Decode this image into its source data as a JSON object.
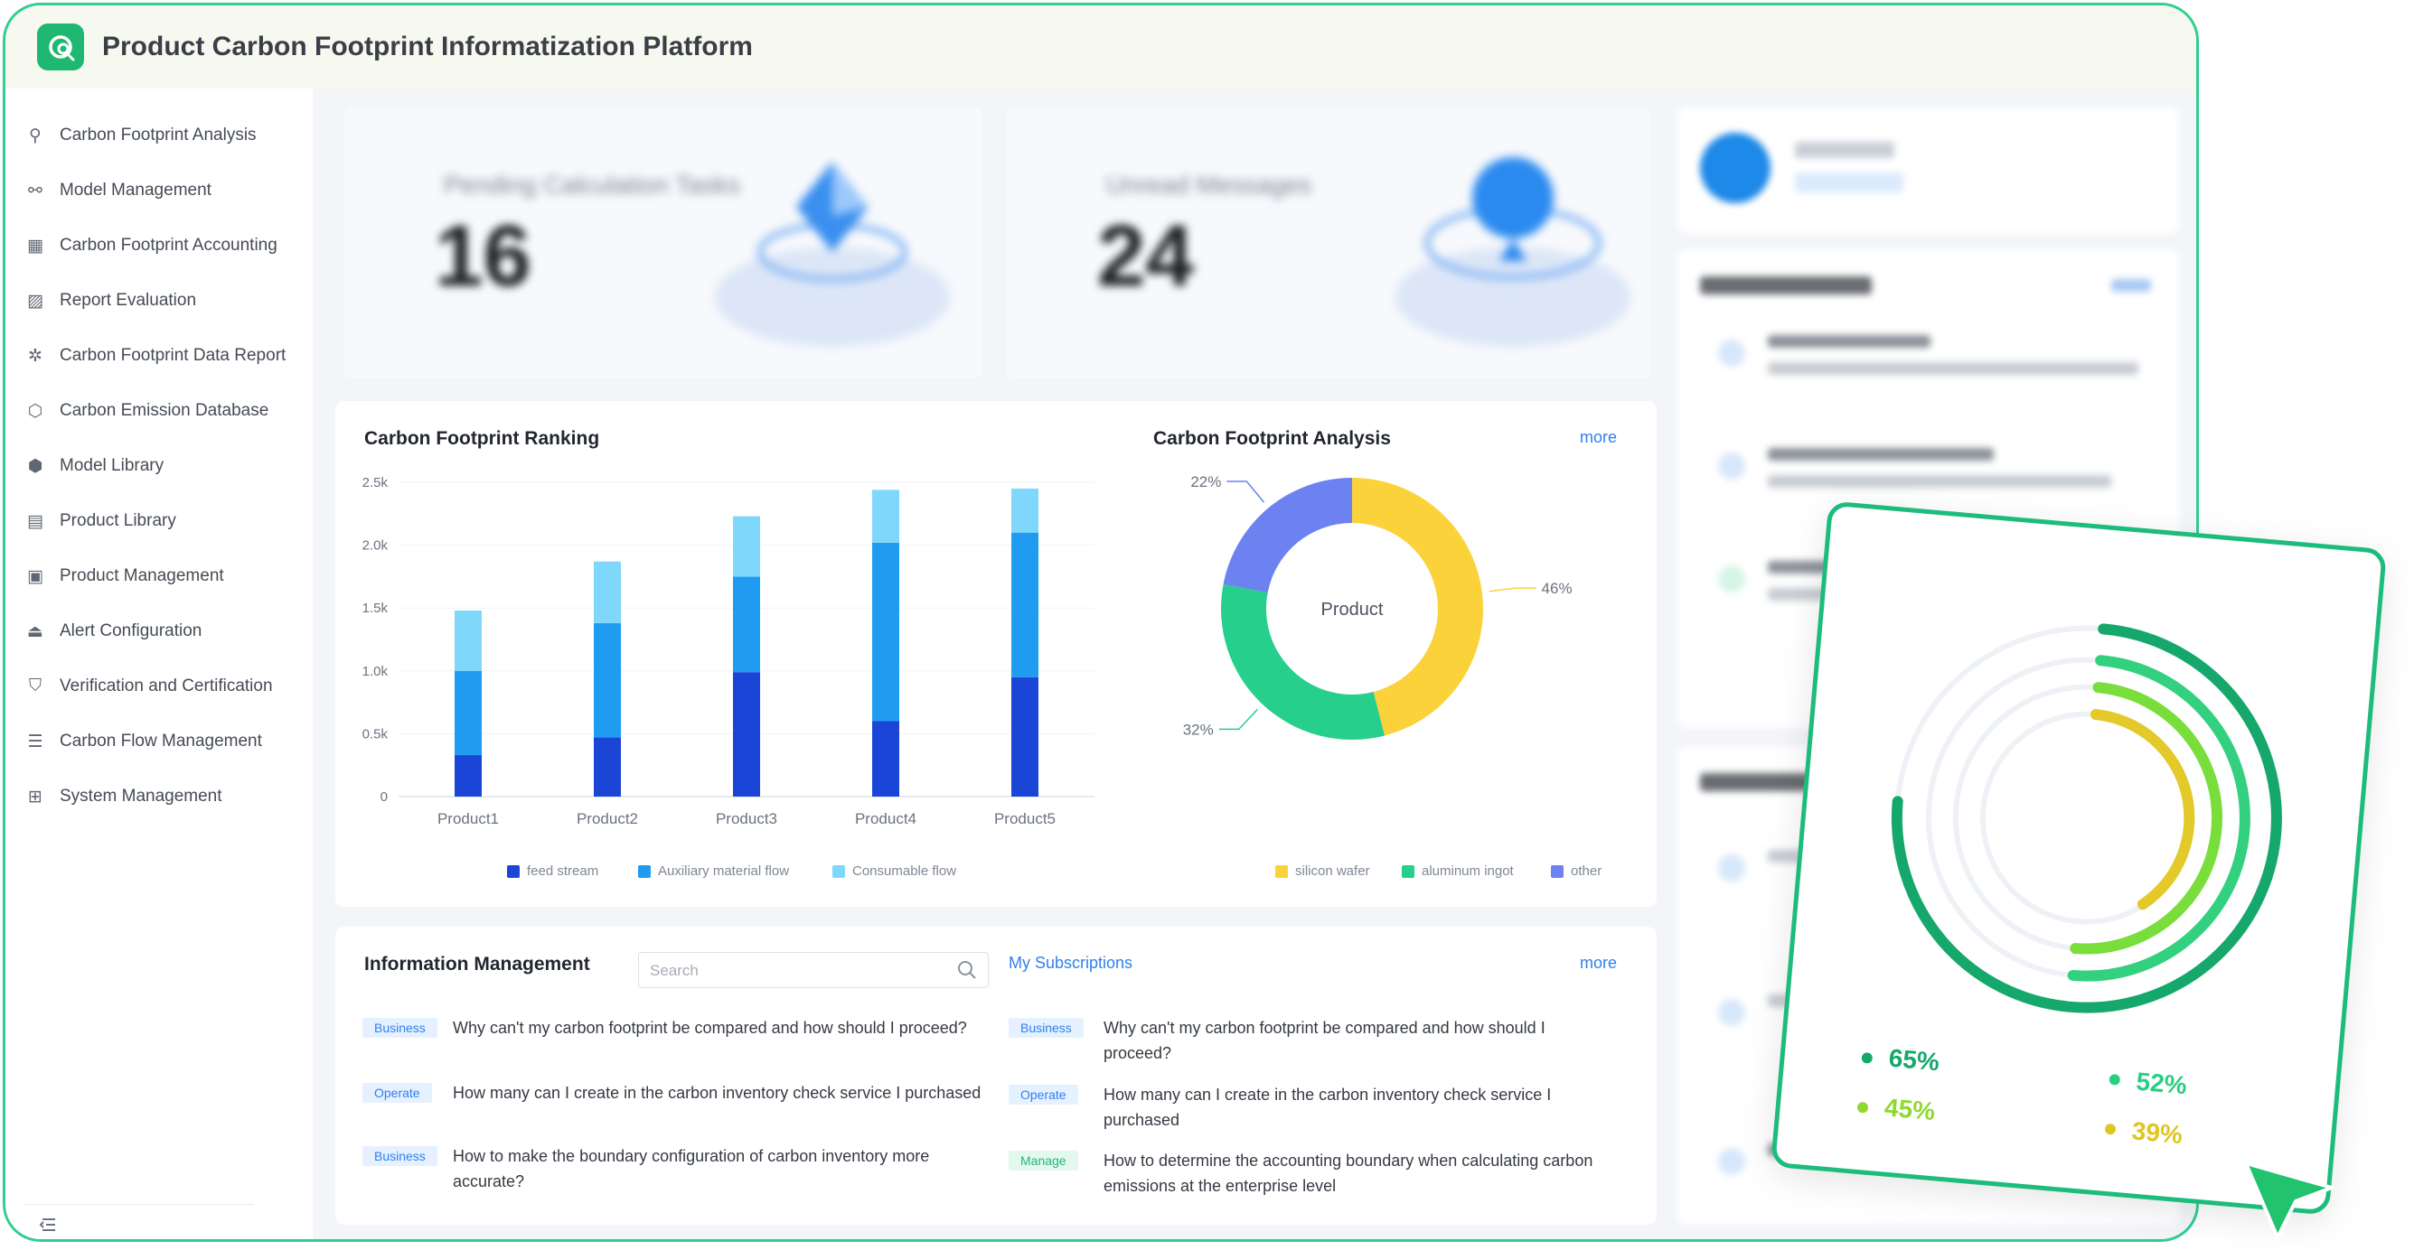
{
  "app": {
    "title": "Product Carbon Footprint Informatization Platform"
  },
  "sidebar": {
    "items": [
      {
        "label": "Carbon Footprint Analysis",
        "icon": "footprint-icon"
      },
      {
        "label": "Model Management",
        "icon": "model-icon"
      },
      {
        "label": "Carbon Footprint Accounting",
        "icon": "calculator-icon"
      },
      {
        "label": "Report Evaluation",
        "icon": "report-icon"
      },
      {
        "label": "Carbon Footprint Data Report",
        "icon": "data-report-icon"
      },
      {
        "label": "Carbon Emission Database",
        "icon": "database-icon"
      },
      {
        "label": "Model Library",
        "icon": "cube-icon"
      },
      {
        "label": "Product Library",
        "icon": "library-icon"
      },
      {
        "label": "Product Management",
        "icon": "product-icon"
      },
      {
        "label": "Alert Configuration",
        "icon": "alert-icon"
      },
      {
        "label": "Verification and Certification",
        "icon": "shield-icon"
      },
      {
        "label": "Carbon Flow Management",
        "icon": "flow-icon"
      },
      {
        "label": "System Management",
        "icon": "settings-icon"
      }
    ]
  },
  "stats": {
    "pending": {
      "label": "Pending Calculation Tasks",
      "value": "16"
    },
    "unread": {
      "label": "Unread Messages",
      "value": "24"
    }
  },
  "ranking": {
    "title": "Carbon Footprint Ranking",
    "y_ticks": [
      "2.5k",
      "2.0k",
      "1.5k",
      "1.0k",
      "0.5k",
      "0"
    ]
  },
  "analysis": {
    "title": "Carbon Footprint Analysis",
    "more": "more",
    "center_label": "Product"
  },
  "chart_data": [
    {
      "type": "bar",
      "stacked": true,
      "title": "Carbon Footprint Ranking",
      "categories": [
        "Product1",
        "Product2",
        "Product3",
        "Product4",
        "Product5"
      ],
      "series": [
        {
          "name": "feed stream",
          "color": "#1a45d6",
          "values": [
            330,
            470,
            990,
            600,
            950
          ]
        },
        {
          "name": "Auxiliary material flow",
          "color": "#1f9cf0",
          "values": [
            670,
            910,
            760,
            1420,
            1150
          ]
        },
        {
          "name": "Consumable flow",
          "color": "#7fd8fb",
          "values": [
            480,
            490,
            480,
            420,
            350
          ]
        }
      ],
      "ylim": [
        0,
        2500
      ],
      "legend": "bottom"
    },
    {
      "type": "pie",
      "title": "Carbon Footprint Analysis",
      "labels": [
        "silicon wafer",
        "aluminum ingot",
        "other"
      ],
      "values": [
        46,
        32,
        22
      ],
      "display_labels": [
        "46%",
        "32%",
        "22%"
      ],
      "colors": [
        "#fbd23a",
        "#27cf8d",
        "#6b82f0"
      ],
      "legend": "bottom"
    }
  ],
  "info": {
    "title": "Information Management",
    "search_placeholder": "Search",
    "subscriptions": "My Subscriptions",
    "more": "more",
    "left": [
      {
        "tag": "Business",
        "tone": "blue",
        "text": "Why can't my carbon footprint be compared and how should I proceed?"
      },
      {
        "tag": "Operate",
        "tone": "blue",
        "text": "How many can I create in the carbon inventory check service I purchased"
      },
      {
        "tag": "Business",
        "tone": "blue",
        "text": "How to make the boundary configuration of carbon inventory more accurate?"
      }
    ],
    "right": [
      {
        "tag": "Business",
        "tone": "blue",
        "text": "Why can't my carbon footprint be compared and how should I proceed?"
      },
      {
        "tag": "Operate",
        "tone": "blue",
        "text": "How many can I create in the carbon inventory check service I purchased"
      },
      {
        "tag": "Manage",
        "tone": "green",
        "text": "How to determine the accounting boundary when calculating carbon emissions at the enterprise level"
      }
    ]
  },
  "overlay": {
    "percentages": [
      "65%",
      "52%",
      "45%",
      "39%"
    ]
  }
}
